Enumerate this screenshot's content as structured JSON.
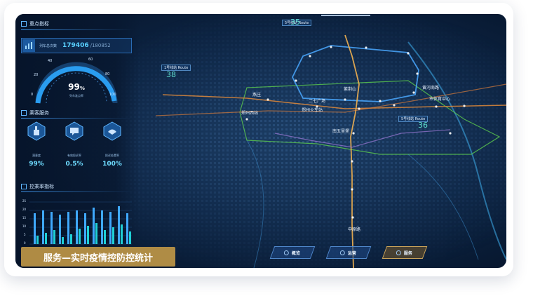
{
  "panel": {
    "key_metrics_title": "重点指标",
    "total_label": "列车总次数",
    "total_value": "179406",
    "total_sub": "/180852",
    "gauge_value": "99",
    "gauge_unit": "%",
    "gauge_label": "列车准点率",
    "gauge_ticks": [
      "0",
      "20",
      "40",
      "60",
      "80",
      "100"
    ],
    "service_title": "乘客服务",
    "services": [
      {
        "name": "满意度",
        "value": "99%",
        "icon": "thumbs-up-icon"
      },
      {
        "name": "有效投诉率",
        "value": "0.5%",
        "icon": "complaint-icon"
      },
      {
        "name": "投诉处置率",
        "value": "100%",
        "icon": "handling-icon"
      }
    ],
    "control_title": "控乘率指标",
    "chart_axis": [
      "25",
      "20",
      "15",
      "10",
      "5",
      "0"
    ]
  },
  "caption": "服务—实时疫情控防控统计",
  "map": {
    "labels": [
      "二七广场",
      "紫荆山",
      "燕庄",
      "南五里堡",
      "中原路",
      "郑州火车站",
      "黄河南路",
      "市体育中心",
      "郑州西站"
    ],
    "box_labels": [
      "5号线站 Route",
      "1号线站 Route",
      "5号线站 Route"
    ],
    "num_labels": [
      "35",
      "38",
      "36"
    ]
  },
  "nav": {
    "overview": "概览",
    "operation": "运营",
    "service": "服务"
  },
  "colors": {
    "accent": "#5fb6ff",
    "gold": "#c9a35a",
    "bg": "#0f2747"
  }
}
